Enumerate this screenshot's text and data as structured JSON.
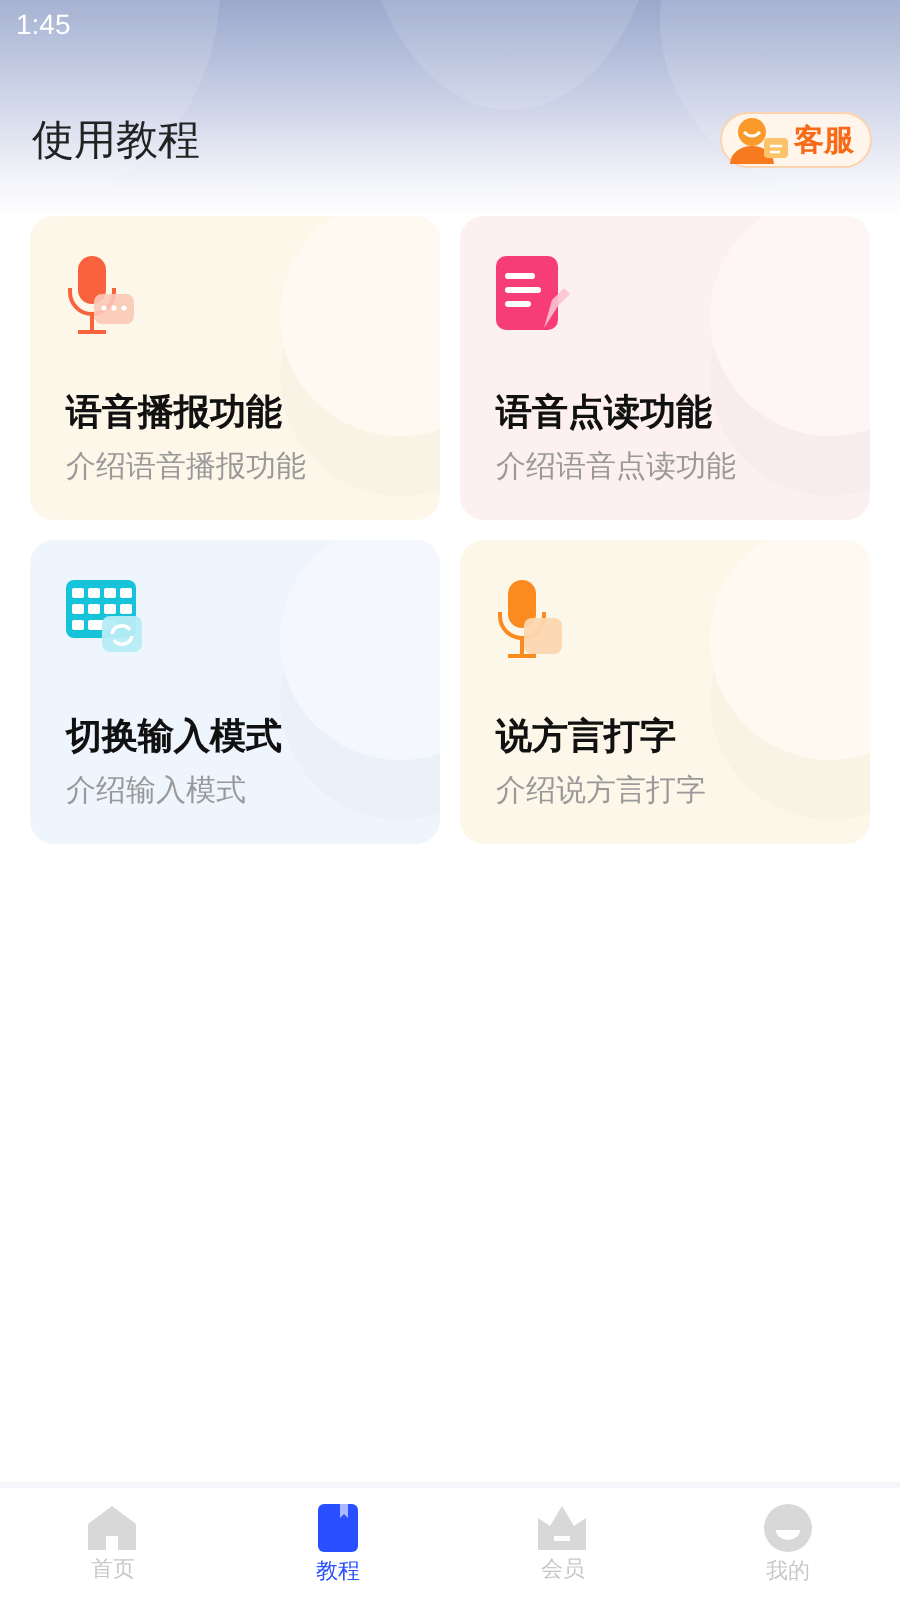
{
  "status_bar": {
    "time": "1:45"
  },
  "header": {
    "title": "使用教程",
    "service_button": "客服"
  },
  "cards": [
    {
      "kind": "mic",
      "color": "#fdf7ea",
      "title": "语音播报功能",
      "subtitle": "介绍语音播报功能"
    },
    {
      "kind": "note",
      "color": "#fdf0f0",
      "title": "语音点读功能",
      "subtitle": "介绍语音点读功能"
    },
    {
      "kind": "keyboard",
      "color": "#eef5fd",
      "title": "切换输入模式",
      "subtitle": "介绍输入模式"
    },
    {
      "kind": "dialect",
      "color": "#fdf7ea",
      "title": "说方言打字",
      "subtitle": "介绍说方言打字"
    }
  ],
  "tabs": [
    {
      "kind": "home",
      "label": "首页",
      "selected": false
    },
    {
      "kind": "book",
      "label": "教程",
      "selected": true
    },
    {
      "kind": "crown",
      "label": "会员",
      "selected": false
    },
    {
      "kind": "face",
      "label": "我的",
      "selected": false
    }
  ]
}
